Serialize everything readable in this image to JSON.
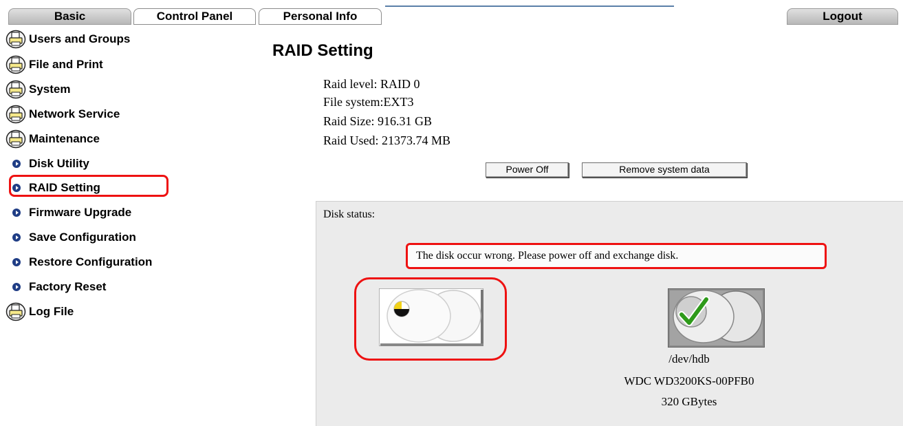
{
  "nav": {
    "tabs": [
      {
        "label": "Basic"
      },
      {
        "label": "Control Panel"
      },
      {
        "label": "Personal Info"
      }
    ],
    "logout_label": "Logout"
  },
  "sidebar": {
    "items": [
      {
        "label": "Users and Groups",
        "icon": "printer-icon"
      },
      {
        "label": "File and Print",
        "icon": "printer-icon"
      },
      {
        "label": "System",
        "icon": "printer-icon"
      },
      {
        "label": "Network Service",
        "icon": "printer-icon"
      },
      {
        "label": "Maintenance",
        "icon": "printer-icon"
      },
      {
        "label": "Disk Utility",
        "icon": "arrow-bullet-icon"
      },
      {
        "label": "RAID Setting",
        "icon": "arrow-bullet-icon",
        "selected": true
      },
      {
        "label": "Firmware Upgrade",
        "icon": "arrow-bullet-icon"
      },
      {
        "label": "Save Configuration",
        "icon": "arrow-bullet-icon"
      },
      {
        "label": "Restore Configuration",
        "icon": "arrow-bullet-icon"
      },
      {
        "label": "Factory Reset",
        "icon": "arrow-bullet-icon"
      },
      {
        "label": "Log File",
        "icon": "printer-icon"
      }
    ]
  },
  "main": {
    "title": "RAID Setting",
    "info": [
      {
        "label": "Raid level:",
        "value": "RAID 0"
      },
      {
        "label": "File system:",
        "value": "EXT3"
      },
      {
        "label": "Raid Size:",
        "value": "916.31 GB"
      },
      {
        "label": "Raid Used:",
        "value": "21373.74 MB"
      }
    ],
    "buttons": {
      "power_off": "Power Off",
      "remove_system_data": "Remove system data"
    },
    "disk_status": {
      "label": "Disk status:",
      "error_message": "The disk occur wrong. Please power off and exchange disk.",
      "disks": [
        {
          "state": "faulty",
          "icon": "disk-warning-icon"
        },
        {
          "state": "ok",
          "icon": "disk-ok-icon",
          "device": "/dev/hdb",
          "model": "WDC WD3200KS-00PFB0",
          "capacity": "320 GBytes"
        }
      ]
    }
  },
  "colors": {
    "highlight": "#e11111",
    "panel_bg": "#ebebeb",
    "bullet": "#1f3d85",
    "check": "#2e9a1a"
  }
}
